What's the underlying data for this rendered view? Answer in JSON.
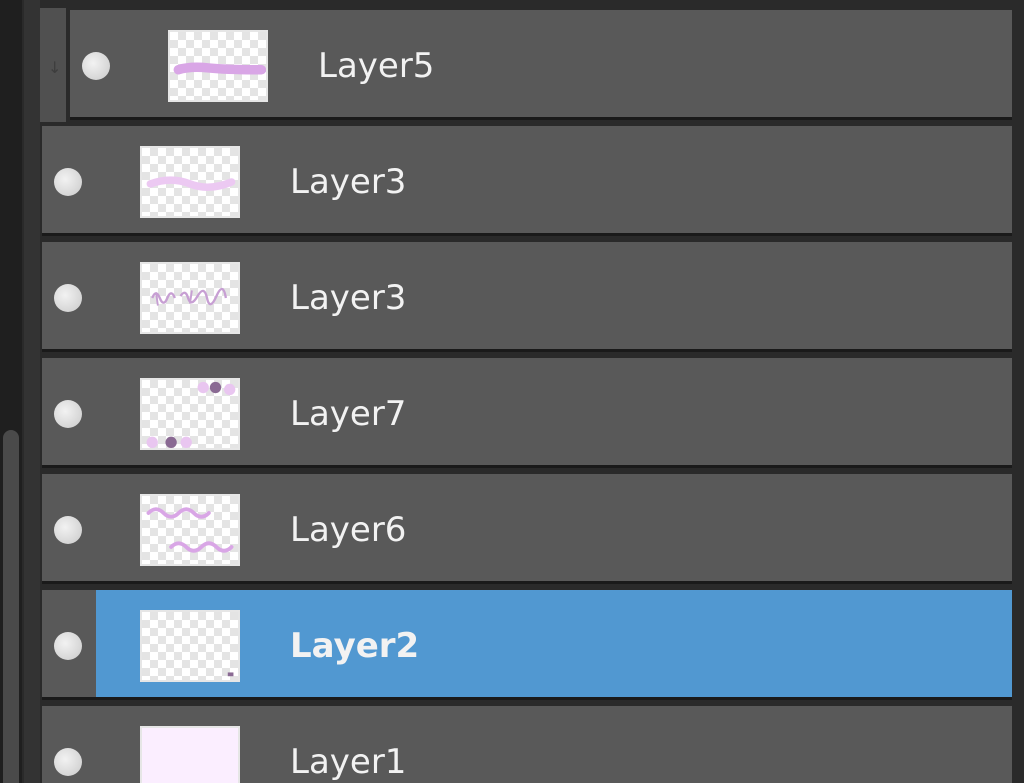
{
  "layers": [
    {
      "name": "Layer5",
      "icon": "layer-thumbnail"
    },
    {
      "name": "Layer3",
      "icon": "layer-thumbnail"
    },
    {
      "name": "Layer3",
      "icon": "layer-thumbnail"
    },
    {
      "name": "Layer7",
      "icon": "layer-thumbnail"
    },
    {
      "name": "Layer6",
      "icon": "layer-thumbnail"
    },
    {
      "name": "Layer2",
      "icon": "layer-thumbnail",
      "selected": true
    },
    {
      "name": "Layer1",
      "icon": "layer-thumbnail"
    }
  ],
  "colors": {
    "row_bg": "#595959",
    "selected_bg": "#5198d1",
    "panel_bg": "#2a2a2a",
    "text": "#f2f2f2",
    "thumb_stroke": "#d9a6e6"
  }
}
